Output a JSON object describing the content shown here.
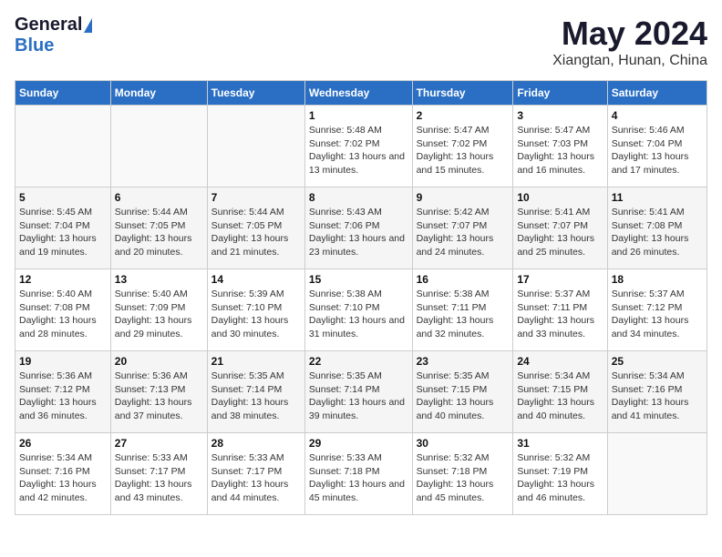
{
  "logo": {
    "general": "General",
    "blue": "Blue"
  },
  "title": "May 2024",
  "subtitle": "Xiangtan, Hunan, China",
  "days_of_week": [
    "Sunday",
    "Monday",
    "Tuesday",
    "Wednesday",
    "Thursday",
    "Friday",
    "Saturday"
  ],
  "weeks": [
    [
      {
        "day": "",
        "sunrise": "",
        "sunset": "",
        "daylight": ""
      },
      {
        "day": "",
        "sunrise": "",
        "sunset": "",
        "daylight": ""
      },
      {
        "day": "",
        "sunrise": "",
        "sunset": "",
        "daylight": ""
      },
      {
        "day": "1",
        "sunrise": "Sunrise: 5:48 AM",
        "sunset": "Sunset: 7:02 PM",
        "daylight": "Daylight: 13 hours and 13 minutes."
      },
      {
        "day": "2",
        "sunrise": "Sunrise: 5:47 AM",
        "sunset": "Sunset: 7:02 PM",
        "daylight": "Daylight: 13 hours and 15 minutes."
      },
      {
        "day": "3",
        "sunrise": "Sunrise: 5:47 AM",
        "sunset": "Sunset: 7:03 PM",
        "daylight": "Daylight: 13 hours and 16 minutes."
      },
      {
        "day": "4",
        "sunrise": "Sunrise: 5:46 AM",
        "sunset": "Sunset: 7:04 PM",
        "daylight": "Daylight: 13 hours and 17 minutes."
      }
    ],
    [
      {
        "day": "5",
        "sunrise": "Sunrise: 5:45 AM",
        "sunset": "Sunset: 7:04 PM",
        "daylight": "Daylight: 13 hours and 19 minutes."
      },
      {
        "day": "6",
        "sunrise": "Sunrise: 5:44 AM",
        "sunset": "Sunset: 7:05 PM",
        "daylight": "Daylight: 13 hours and 20 minutes."
      },
      {
        "day": "7",
        "sunrise": "Sunrise: 5:44 AM",
        "sunset": "Sunset: 7:05 PM",
        "daylight": "Daylight: 13 hours and 21 minutes."
      },
      {
        "day": "8",
        "sunrise": "Sunrise: 5:43 AM",
        "sunset": "Sunset: 7:06 PM",
        "daylight": "Daylight: 13 hours and 23 minutes."
      },
      {
        "day": "9",
        "sunrise": "Sunrise: 5:42 AM",
        "sunset": "Sunset: 7:07 PM",
        "daylight": "Daylight: 13 hours and 24 minutes."
      },
      {
        "day": "10",
        "sunrise": "Sunrise: 5:41 AM",
        "sunset": "Sunset: 7:07 PM",
        "daylight": "Daylight: 13 hours and 25 minutes."
      },
      {
        "day": "11",
        "sunrise": "Sunrise: 5:41 AM",
        "sunset": "Sunset: 7:08 PM",
        "daylight": "Daylight: 13 hours and 26 minutes."
      }
    ],
    [
      {
        "day": "12",
        "sunrise": "Sunrise: 5:40 AM",
        "sunset": "Sunset: 7:08 PM",
        "daylight": "Daylight: 13 hours and 28 minutes."
      },
      {
        "day": "13",
        "sunrise": "Sunrise: 5:40 AM",
        "sunset": "Sunset: 7:09 PM",
        "daylight": "Daylight: 13 hours and 29 minutes."
      },
      {
        "day": "14",
        "sunrise": "Sunrise: 5:39 AM",
        "sunset": "Sunset: 7:10 PM",
        "daylight": "Daylight: 13 hours and 30 minutes."
      },
      {
        "day": "15",
        "sunrise": "Sunrise: 5:38 AM",
        "sunset": "Sunset: 7:10 PM",
        "daylight": "Daylight: 13 hours and 31 minutes."
      },
      {
        "day": "16",
        "sunrise": "Sunrise: 5:38 AM",
        "sunset": "Sunset: 7:11 PM",
        "daylight": "Daylight: 13 hours and 32 minutes."
      },
      {
        "day": "17",
        "sunrise": "Sunrise: 5:37 AM",
        "sunset": "Sunset: 7:11 PM",
        "daylight": "Daylight: 13 hours and 33 minutes."
      },
      {
        "day": "18",
        "sunrise": "Sunrise: 5:37 AM",
        "sunset": "Sunset: 7:12 PM",
        "daylight": "Daylight: 13 hours and 34 minutes."
      }
    ],
    [
      {
        "day": "19",
        "sunrise": "Sunrise: 5:36 AM",
        "sunset": "Sunset: 7:12 PM",
        "daylight": "Daylight: 13 hours and 36 minutes."
      },
      {
        "day": "20",
        "sunrise": "Sunrise: 5:36 AM",
        "sunset": "Sunset: 7:13 PM",
        "daylight": "Daylight: 13 hours and 37 minutes."
      },
      {
        "day": "21",
        "sunrise": "Sunrise: 5:35 AM",
        "sunset": "Sunset: 7:14 PM",
        "daylight": "Daylight: 13 hours and 38 minutes."
      },
      {
        "day": "22",
        "sunrise": "Sunrise: 5:35 AM",
        "sunset": "Sunset: 7:14 PM",
        "daylight": "Daylight: 13 hours and 39 minutes."
      },
      {
        "day": "23",
        "sunrise": "Sunrise: 5:35 AM",
        "sunset": "Sunset: 7:15 PM",
        "daylight": "Daylight: 13 hours and 40 minutes."
      },
      {
        "day": "24",
        "sunrise": "Sunrise: 5:34 AM",
        "sunset": "Sunset: 7:15 PM",
        "daylight": "Daylight: 13 hours and 40 minutes."
      },
      {
        "day": "25",
        "sunrise": "Sunrise: 5:34 AM",
        "sunset": "Sunset: 7:16 PM",
        "daylight": "Daylight: 13 hours and 41 minutes."
      }
    ],
    [
      {
        "day": "26",
        "sunrise": "Sunrise: 5:34 AM",
        "sunset": "Sunset: 7:16 PM",
        "daylight": "Daylight: 13 hours and 42 minutes."
      },
      {
        "day": "27",
        "sunrise": "Sunrise: 5:33 AM",
        "sunset": "Sunset: 7:17 PM",
        "daylight": "Daylight: 13 hours and 43 minutes."
      },
      {
        "day": "28",
        "sunrise": "Sunrise: 5:33 AM",
        "sunset": "Sunset: 7:17 PM",
        "daylight": "Daylight: 13 hours and 44 minutes."
      },
      {
        "day": "29",
        "sunrise": "Sunrise: 5:33 AM",
        "sunset": "Sunset: 7:18 PM",
        "daylight": "Daylight: 13 hours and 45 minutes."
      },
      {
        "day": "30",
        "sunrise": "Sunrise: 5:32 AM",
        "sunset": "Sunset: 7:18 PM",
        "daylight": "Daylight: 13 hours and 45 minutes."
      },
      {
        "day": "31",
        "sunrise": "Sunrise: 5:32 AM",
        "sunset": "Sunset: 7:19 PM",
        "daylight": "Daylight: 13 hours and 46 minutes."
      },
      {
        "day": "",
        "sunrise": "",
        "sunset": "",
        "daylight": ""
      }
    ]
  ]
}
